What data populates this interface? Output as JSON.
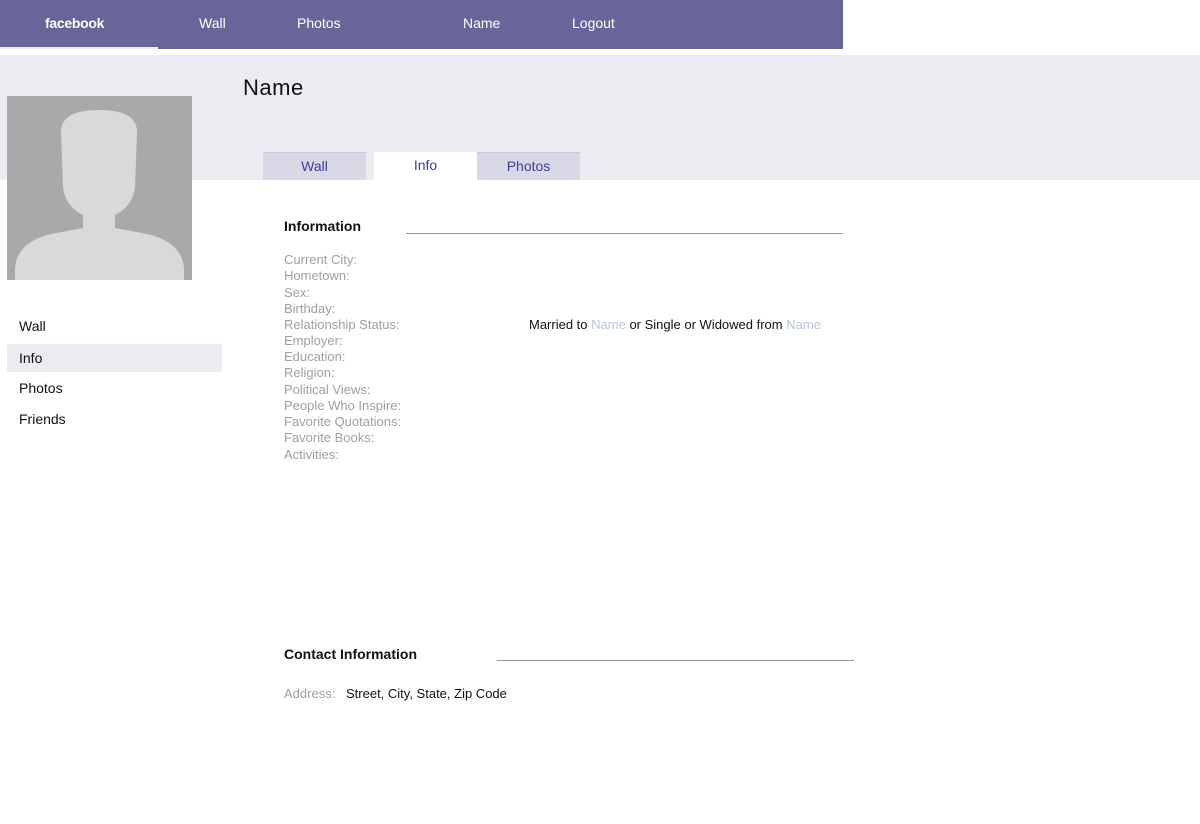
{
  "topbar": {
    "brand": "facebook",
    "items": [
      "Wall",
      "Photos",
      "Name",
      "Logout"
    ]
  },
  "profile": {
    "name": "Name"
  },
  "tabs": [
    {
      "label": "Wall",
      "active": false
    },
    {
      "label": "Info",
      "active": true
    },
    {
      "label": "Photos",
      "active": false
    }
  ],
  "sidebar": {
    "items": [
      {
        "label": "Wall",
        "selected": false
      },
      {
        "label": "Info",
        "selected": true
      },
      {
        "label": "Photos",
        "selected": false
      },
      {
        "label": "Friends",
        "selected": false
      }
    ]
  },
  "information": {
    "title": "Information",
    "fields": [
      "Current City:",
      "Hometown:",
      "Sex:",
      "Birthday:",
      "Relationship Status:",
      "Employer:",
      "Education:",
      "Religion:",
      "Political Views:",
      "People Who Inspire:",
      "Favorite Quotations:",
      "Favorite Books:",
      "Activities:"
    ],
    "relationship": {
      "prefix": "Married to ",
      "link1": "Name",
      "middle": " or Single or Widowed from ",
      "link2": "Name"
    }
  },
  "contact": {
    "title": "Contact Information",
    "address_label": "Address:",
    "address_value": "Street, City, State, Zip Code"
  },
  "colors": {
    "topbar": "#67659a",
    "header_band": "#ebebf2",
    "tab_text": "#3b3ba0",
    "label_gray": "#a0a0a0",
    "link_light": "#b8c7dc"
  }
}
